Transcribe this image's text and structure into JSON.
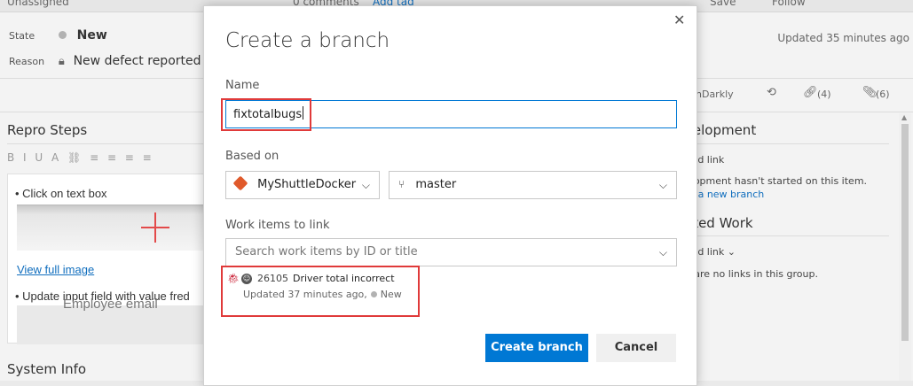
{
  "background": {
    "topbar": {
      "assigned": "Unassigned",
      "comments": "0 comments",
      "add_tag": "Add tag",
      "save": "Save",
      "follow": "Follow"
    },
    "state": {
      "label": "State",
      "value": "New"
    },
    "reason": {
      "label": "Reason",
      "value": "New defect reported"
    },
    "updated": "Updated 35 minutes ago",
    "tabs": {
      "launchdarkly": "nDarkly",
      "links": "(4)",
      "attachments": "(6)"
    },
    "repro_steps": {
      "title": "Repro Steps",
      "toolbar": "B I U A ⛓ ≡ ≡ ≡ ≡",
      "step1": "Click on text box",
      "view_full_image": "View full image",
      "step2": "Update input field with value fred",
      "image2_text": "Employee email"
    },
    "system_info": "System Info",
    "development": {
      "title": "velopment",
      "add_link": "Add link",
      "text": "elopment hasn't started on this item.",
      "create_link": "te a new branch"
    },
    "related_work": {
      "title": "ated Work",
      "add_link": "Add link ⌄",
      "text": "e are no links in this group."
    }
  },
  "dialog": {
    "title": "Create a branch",
    "name_label": "Name",
    "name_value": "fixtotalbugs",
    "based_on_label": "Based on",
    "repo": "MyShuttleDocker",
    "branch": "master",
    "work_items_label": "Work items to link",
    "search_placeholder": "Search work items by ID or title",
    "linked_item": {
      "id": "26105",
      "title": "Driver total incorrect",
      "updated": "Updated 37 minutes ago,",
      "state": "New"
    },
    "create_button": "Create branch",
    "cancel_button": "Cancel",
    "close_glyph": "✕"
  },
  "colors": {
    "accent": "#0078d4",
    "highlight": "#e03a3a",
    "repo_icon": "#e05a2b",
    "bug_icon": "#cc293d"
  }
}
